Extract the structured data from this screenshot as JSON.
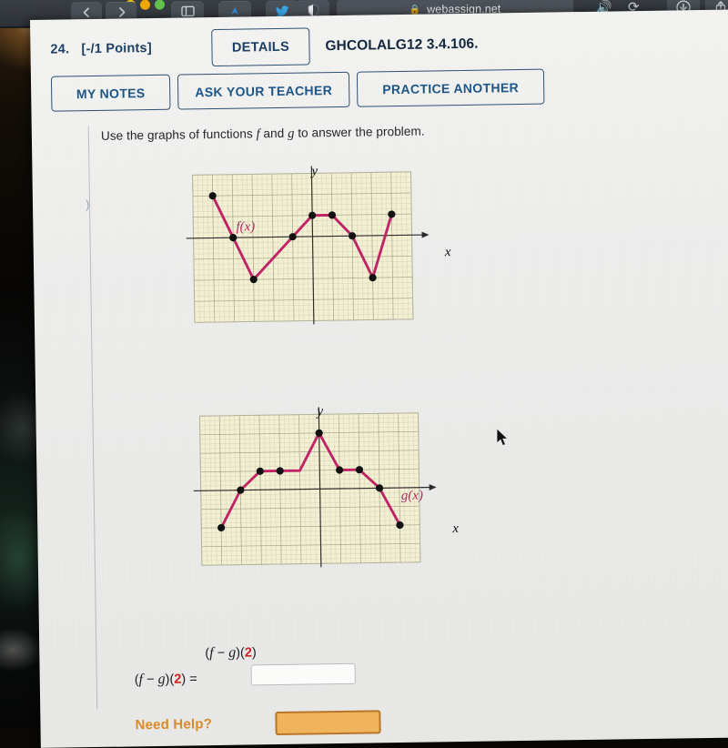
{
  "browser": {
    "url": "webassign.net",
    "lock_icon": "lock-icon",
    "back_icon": "back-chevron-icon",
    "forward_icon": "forward-chevron-icon",
    "sidebar_icon": "sidebar-toggle-icon",
    "ext_icon_1": "extension-icon-blue",
    "ext_icon_2": "twitter-bird-icon",
    "ext_icon_3": "shield-icon",
    "mute_icon": "speaker-icon",
    "reload_icon": "reload-icon",
    "download_icon": "download-icon",
    "share_icon": "share-icon",
    "traffic_colors": [
      "#f2c200",
      "#f0a800",
      "#5fc14a"
    ]
  },
  "header": {
    "problem_number": "24.",
    "points": "[-/1 Points]",
    "details_label": "DETAILS",
    "problem_code": "GHCOLALG12 3.4.106."
  },
  "actions": {
    "my_notes": "MY NOTES",
    "ask_your_teacher": "ASK YOUR TEACHER",
    "practice_another": "PRACTICE ANOTHER"
  },
  "prompt": {
    "part1": "Use the graphs of functions ",
    "f": "f",
    "part2": " and ",
    "g": "g",
    "part3": " to answer the problem."
  },
  "answer": {
    "expression_top": "(f − g)(2)",
    "expression_line": "(f − g)(2) =",
    "input_value": "",
    "input_placeholder": "",
    "need_help_label": "Need Help?",
    "help_button_label": ""
  },
  "chart_data": [
    {
      "id": "graph-f",
      "type": "line",
      "title": "",
      "function_label": "f(x)",
      "xlabel": "x",
      "ylabel": "y",
      "xlim": [
        -6,
        5
      ],
      "ylim": [
        -4,
        3
      ],
      "grid": true,
      "minor_grid": true,
      "x": [
        -5,
        -4,
        -3,
        -1,
        0,
        1,
        2,
        3,
        4
      ],
      "y": [
        2,
        0,
        -2,
        0,
        1,
        1,
        0,
        -2,
        1
      ],
      "markers": true,
      "line_color": "#bf2466",
      "plot_bg": "#f2efd2",
      "grid_color": "#9c9c86"
    },
    {
      "id": "graph-g",
      "type": "line",
      "title": "",
      "function_label": "g(x)",
      "xlabel": "x",
      "ylabel": "y",
      "xlim": [
        -6,
        5
      ],
      "ylim": [
        -4,
        4
      ],
      "grid": true,
      "minor_grid": true,
      "x": [
        -5,
        -4,
        -3,
        -2,
        -1,
        0,
        1,
        2,
        3,
        4
      ],
      "y": [
        -2,
        0,
        1,
        1,
        1,
        3,
        1,
        1,
        0,
        -2
      ],
      "markers": true,
      "marker_x": [
        -5,
        -4,
        -3,
        -2,
        0,
        1,
        2,
        3,
        4
      ],
      "marker_y": [
        -2,
        0,
        1,
        1,
        3,
        1,
        1,
        0,
        -2
      ],
      "line_color": "#bf2466",
      "plot_bg": "#f2efd2",
      "grid_color": "#9c9c86"
    }
  ]
}
